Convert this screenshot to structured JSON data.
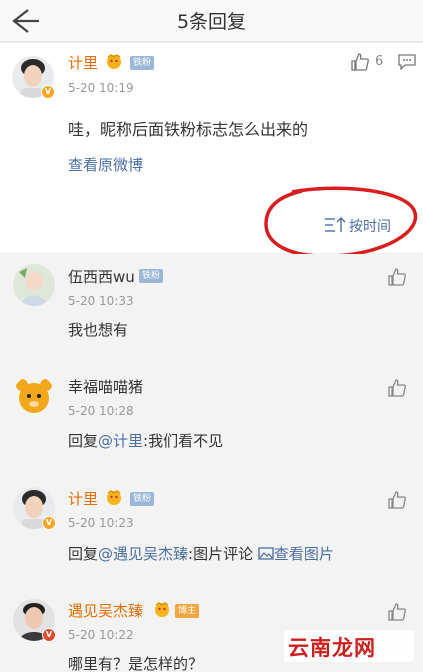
{
  "header": {
    "title": "5条回复"
  },
  "original": {
    "username": "计里",
    "fan_tag": "铁粉",
    "time": "5-20 10:19",
    "likes": "6",
    "content": "哇，昵称后面铁粉标志怎么出来的",
    "view_original": "查看原微博"
  },
  "sort": {
    "label": "按时间"
  },
  "replies": [
    {
      "username": "伍西西wu",
      "tag": "铁粉",
      "time": "5-20 10:33",
      "content": "我也想有"
    },
    {
      "username": "幸福喵喵猪",
      "time": "5-20 10:28",
      "prefix": "回复",
      "mention": "@计里",
      "rest": ":我们看不见"
    },
    {
      "username": "计里",
      "tag": "铁粉",
      "time": "5-20 10:23",
      "prefix": "回复",
      "mention": "@遇见吴杰臻",
      "rest": ":图片评论 ",
      "pic_link": "查看图片"
    },
    {
      "username": "遇见吴杰臻",
      "tag": "博主",
      "time": "5-20 10:22",
      "content": "哪里有？是怎样的？"
    }
  ],
  "watermark": "云南龙网",
  "colors": {
    "orange_name": "#e86c00",
    "link_blue": "#4a6fa5",
    "circle_red": "#d81e1e"
  }
}
